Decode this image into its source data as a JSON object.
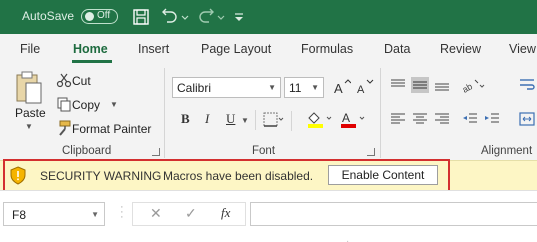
{
  "titlebar": {
    "autosave_label": "AutoSave",
    "autosave_state": "Off",
    "accent": "#217346"
  },
  "menu": {
    "tabs": [
      "File",
      "Home",
      "Insert",
      "Page Layout",
      "Formulas",
      "Data",
      "Review",
      "View"
    ],
    "active": "Home"
  },
  "ribbon": {
    "clipboard": {
      "paste_label": "Paste",
      "cut_label": "Cut",
      "copy_label": "Copy",
      "format_painter_label": "Format Painter",
      "group_label": "Clipboard"
    },
    "font": {
      "font_name": "Calibri",
      "font_size": "11",
      "group_label": "Font",
      "bold": "B",
      "italic": "I",
      "underline": "U",
      "highlight_color": "#ffff00",
      "font_color": "#e00000"
    },
    "alignment": {
      "group_label": "Alignment"
    }
  },
  "security": {
    "title": "SECURITY WARNING",
    "message": "Macros have been disabled.",
    "button_label": "Enable Content",
    "bar_color": "#fdf6c5",
    "outline_color": "#d32f2f"
  },
  "formula_bar": {
    "cell_ref": "F8",
    "cancel_symbol": "✕",
    "enter_symbol": "✓",
    "fx_label": "fx",
    "formula": ""
  }
}
